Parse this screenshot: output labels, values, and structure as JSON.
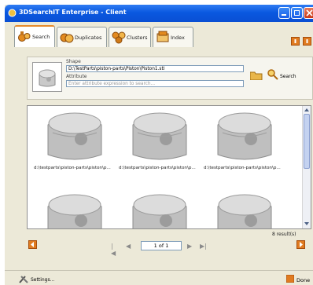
{
  "window": {
    "title": "3DSearchIT Enterprise - Client"
  },
  "tabs": [
    {
      "label": "Search",
      "icon": "binoculars-icon",
      "active": true
    },
    {
      "label": "Duplicates",
      "icon": "duplicates-icon",
      "active": false
    },
    {
      "label": "Clusters",
      "icon": "clusters-icon",
      "active": false
    },
    {
      "label": "Index",
      "icon": "index-icon",
      "active": false
    }
  ],
  "search_panel": {
    "shape_label": "Shape",
    "shape_value": "D:\\TestParts\\piston-parts\\Piston\\Piston1.stl",
    "attribute_label": "Attribute",
    "attribute_placeholder": "Enter attribute expression to search...",
    "search_button": "Search"
  },
  "results": [
    {
      "caption": "d:\\testparts\\piston-parts\\piston\\p..."
    },
    {
      "caption": "d:\\testparts\\piston-parts\\piston\\p..."
    },
    {
      "caption": "d:\\testparts\\piston-parts\\piston\\p..."
    },
    {
      "caption": ""
    },
    {
      "caption": ""
    },
    {
      "caption": ""
    }
  ],
  "results_count": "8 result(s)",
  "pager": {
    "page": "1 of 1"
  },
  "status": {
    "settings_label": "Settings...",
    "done_label": "Done"
  },
  "colors": {
    "title_bar": "#0a58e0",
    "active_tab": "#e68b2c",
    "accent_button": "#e07b20"
  }
}
